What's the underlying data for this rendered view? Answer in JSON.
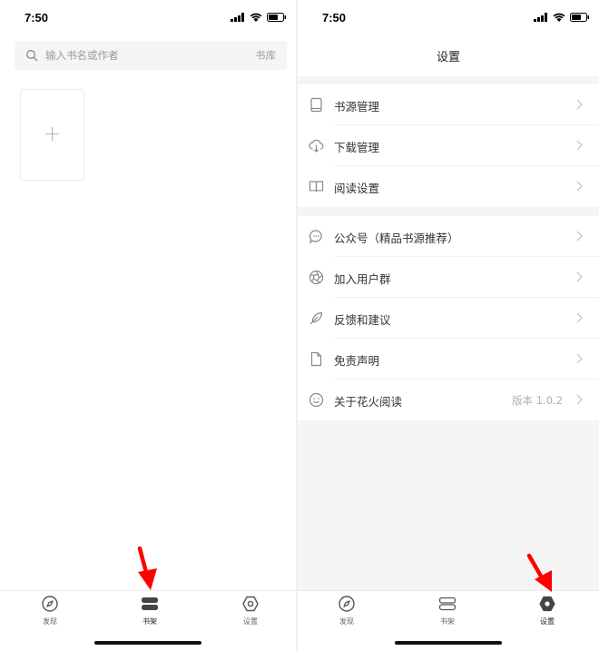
{
  "status_bar": {
    "time": "7:50"
  },
  "bookshelf": {
    "search_placeholder": "输入书名或作者",
    "library_link": "书库",
    "add_book_glyph": "+"
  },
  "settings": {
    "title": "设置",
    "group1": [
      {
        "label": "书源管理",
        "icon": "book-icon"
      },
      {
        "label": "下载管理",
        "icon": "cloud-download-icon"
      },
      {
        "label": "阅读设置",
        "icon": "open-book-icon"
      }
    ],
    "group2": [
      {
        "label": "公众号（精品书源推荐）",
        "icon": "chat-bubble-icon"
      },
      {
        "label": "加入用户群",
        "icon": "aperture-icon"
      },
      {
        "label": "反馈和建议",
        "icon": "feather-icon"
      },
      {
        "label": "免责声明",
        "icon": "document-icon"
      },
      {
        "label": "关于花火阅读",
        "icon": "smile-icon",
        "value": "版本 1.0.2"
      }
    ]
  },
  "tabs": {
    "discover": "发现",
    "bookshelf": "书架",
    "settings": "设置"
  },
  "colors": {
    "accent_arrow": "#ff0000",
    "text_dark": "#222222",
    "muted": "#9a9a9a",
    "background_gray": "#f5f5f5"
  }
}
